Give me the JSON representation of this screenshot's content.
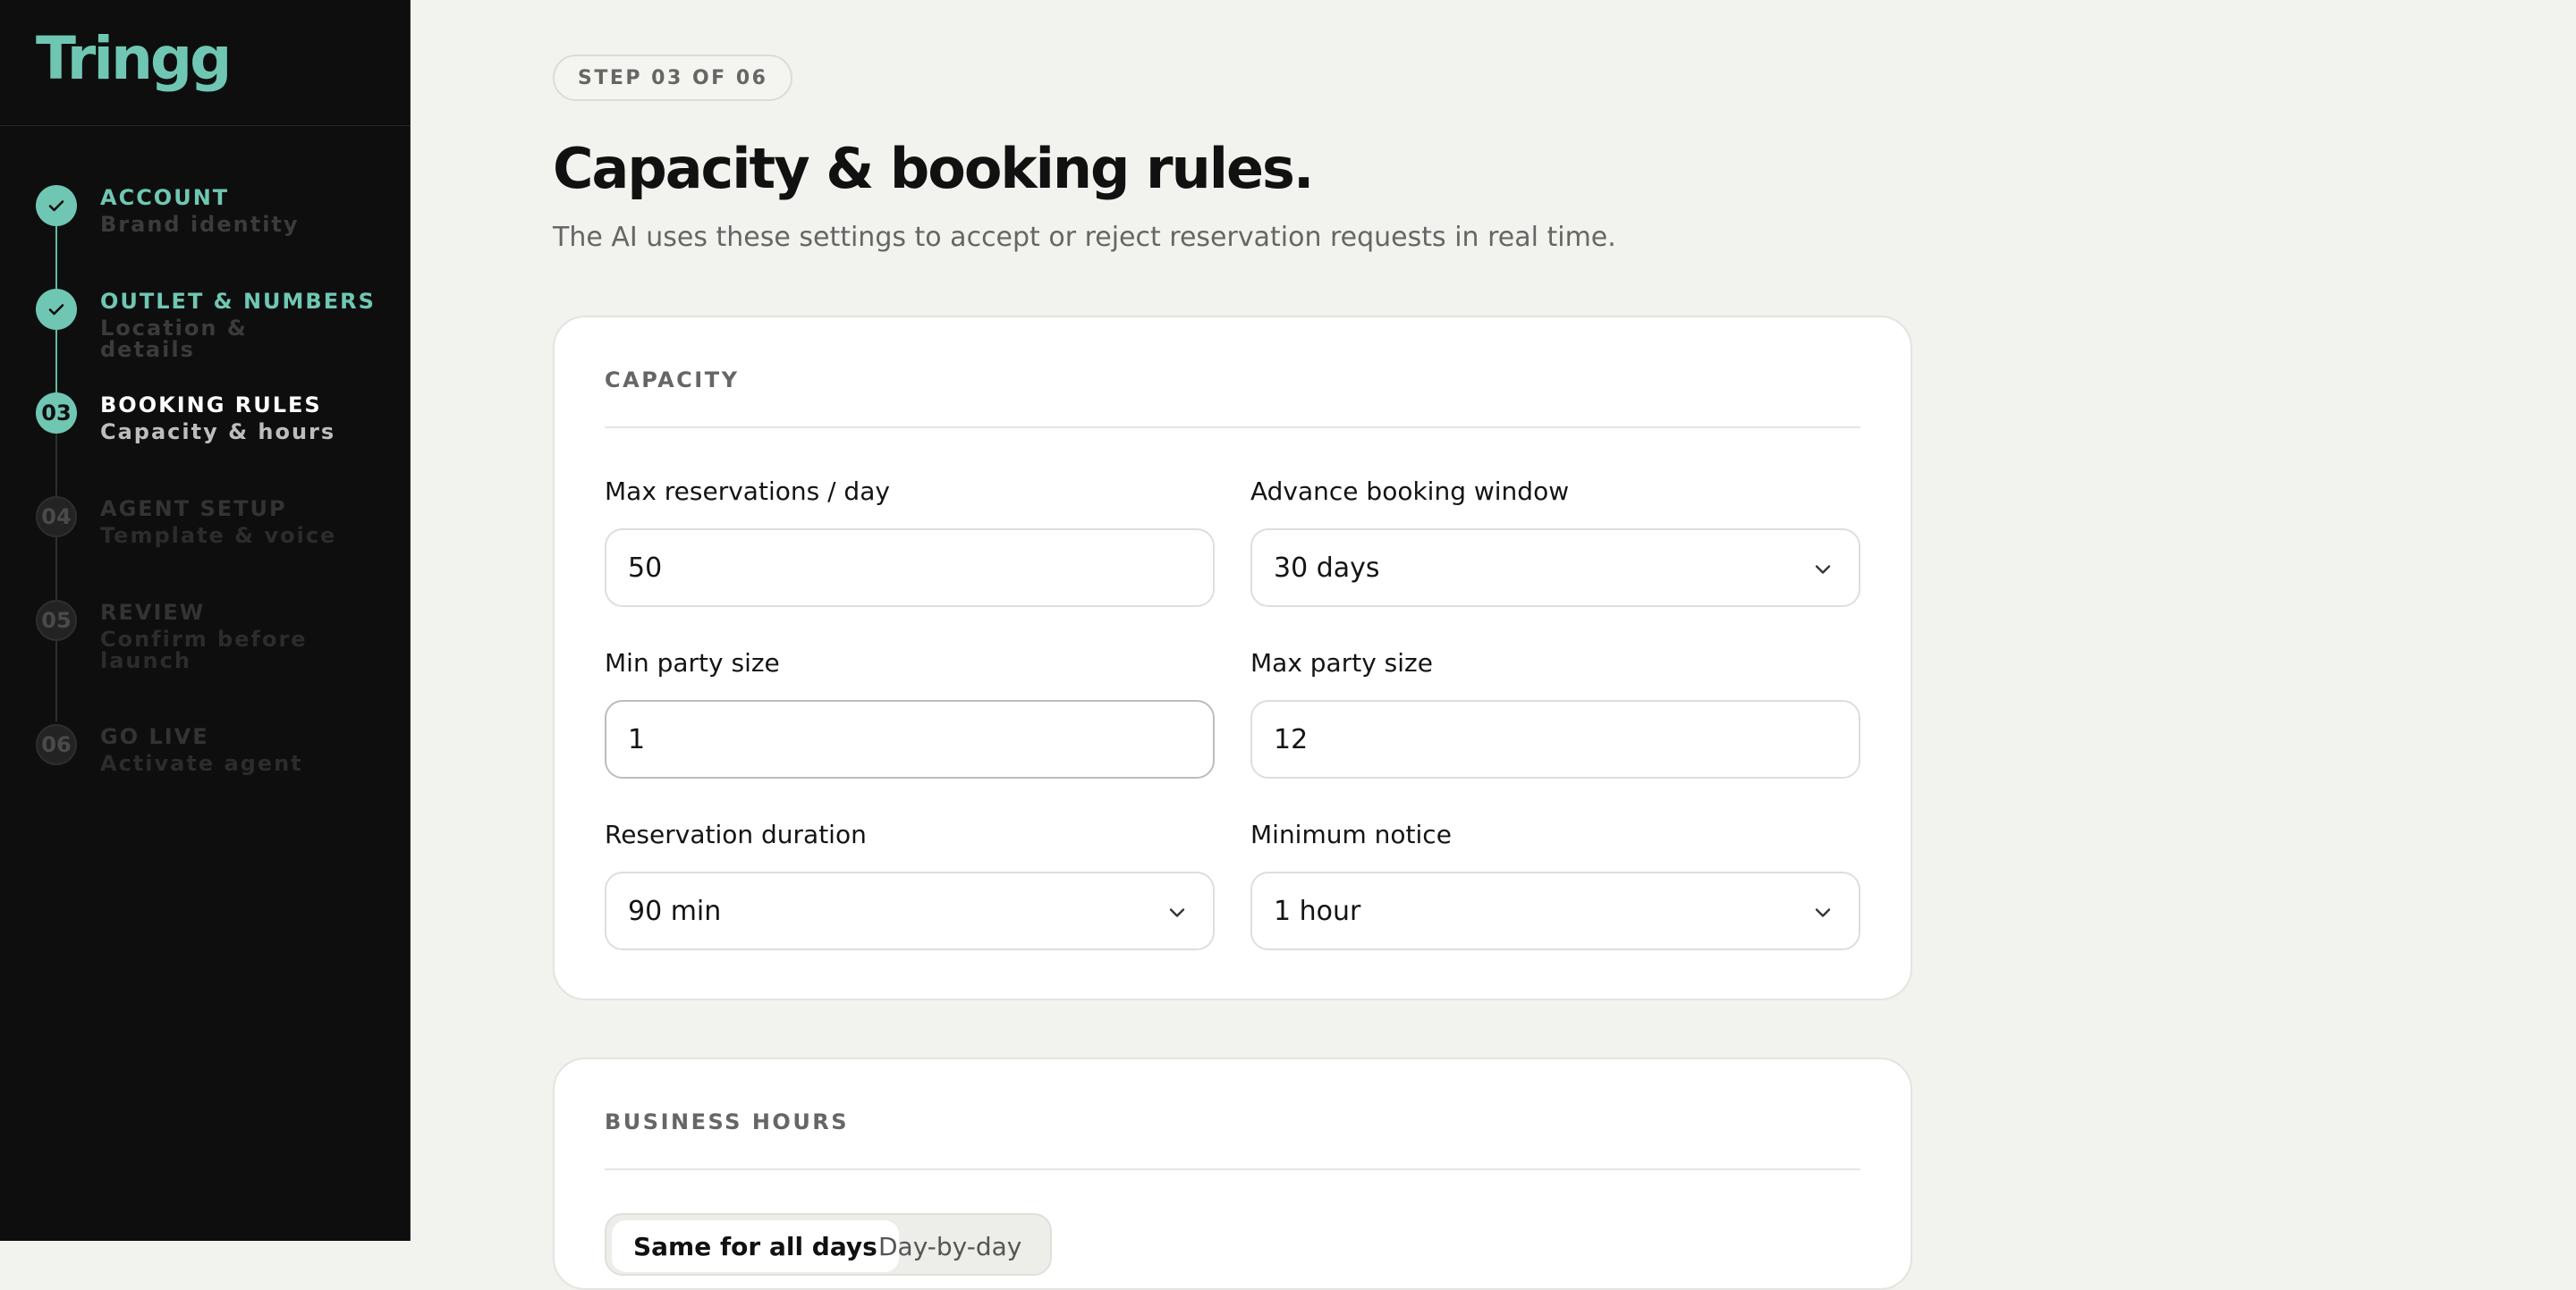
{
  "brand": {
    "logo_text": "Tringg",
    "accent": "#6fc7b3"
  },
  "steps": [
    {
      "marker": "",
      "title": "ACCOUNT",
      "subtitle": "Brand identity",
      "state": "done"
    },
    {
      "marker": "",
      "title": "OUTLET & NUMBERS",
      "subtitle": "Location & details",
      "state": "done"
    },
    {
      "marker": "03",
      "title": "BOOKING RULES",
      "subtitle": "Capacity & hours",
      "state": "active"
    },
    {
      "marker": "04",
      "title": "AGENT SETUP",
      "subtitle": "Template & voice",
      "state": "pending"
    },
    {
      "marker": "05",
      "title": "REVIEW",
      "subtitle": "Confirm before launch",
      "state": "pending"
    },
    {
      "marker": "06",
      "title": "GO LIVE",
      "subtitle": "Activate agent",
      "state": "pending"
    }
  ],
  "header": {
    "step_badge": "STEP 03 OF 06",
    "title": "Capacity & booking rules.",
    "subtitle": "The AI uses these settings to accept or reject reservation requests in real time."
  },
  "capacity": {
    "heading": "CAPACITY",
    "max_reservations": {
      "label": "Max reservations / day",
      "value": "50"
    },
    "advance_window": {
      "label": "Advance booking window",
      "value": "30 days"
    },
    "min_party": {
      "label": "Min party size",
      "value": "1"
    },
    "max_party": {
      "label": "Max party size",
      "value": "12"
    },
    "duration": {
      "label": "Reservation duration",
      "value": "90 min"
    },
    "min_notice": {
      "label": "Minimum notice",
      "value": "1 hour"
    }
  },
  "hours": {
    "heading": "BUSINESS HOURS",
    "options": [
      "Same for all days",
      "Day-by-day"
    ],
    "selected": "Same for all days"
  }
}
